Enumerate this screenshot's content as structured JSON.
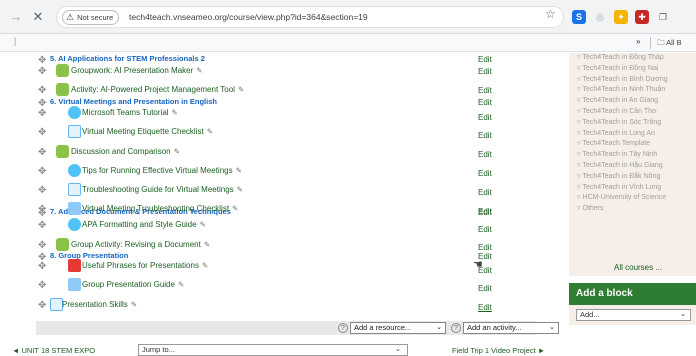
{
  "browser": {
    "nav_forward": "→",
    "nav_close": "✕",
    "security_label": "Not secure",
    "url": "tech4teach.vnseameo.org/course/view.php?id=364&section=19",
    "bookmarks_more": "»",
    "bookmarks_folder": "All B",
    "extensions": [
      {
        "icon": "s-extension-icon",
        "glyph": "S",
        "color": "#1a73e8"
      },
      {
        "icon": "shield-extension-icon",
        "glyph": "◎",
        "color": "#9aa0a6"
      },
      {
        "icon": "rocket-extension-icon",
        "glyph": "✦",
        "color": "#f4b400"
      },
      {
        "icon": "puzzle-extension-icon",
        "glyph": "✚",
        "color": "#c62828"
      },
      {
        "icon": "copy-extension-icon",
        "glyph": "❐",
        "color": "#5f6368"
      }
    ]
  },
  "course": {
    "sections": [
      {
        "title": "5. AI Applications for STEM Professionals 2"
      },
      {
        "title": "6. Virtual Meetings and Presentation in English"
      },
      {
        "title": "7. Advanced Document & Presentation Techniques"
      },
      {
        "title": "8. Group Presentation"
      }
    ],
    "activities": [
      {
        "name": "Groupwork: AI Presentation Maker",
        "icon": "forum-icon"
      },
      {
        "name": "Activity: AI-Powered Project Management Tool",
        "icon": "forum-icon"
      },
      {
        "name": "Microsoft Teams Tutorial",
        "icon": "url-icon"
      },
      {
        "name": "Virtual Meeting Etiquette Checklist",
        "icon": "file-icon"
      },
      {
        "name": "Discussion and Comparison",
        "icon": "forum-icon"
      },
      {
        "name": "Tips for Running Effective Virtual Meetings",
        "icon": "url-icon"
      },
      {
        "name": "Troubleshooting Guide for Virtual Meetings",
        "icon": "file-icon"
      },
      {
        "name": "Virtual Meeting Troubleshooting Checklist",
        "icon": "assignment-icon"
      },
      {
        "name": "APA Formatting and Style Guide",
        "icon": "url-icon"
      },
      {
        "name": "Group Activity: Revising a Document",
        "icon": "forum-icon"
      },
      {
        "name": "Useful Phrases for Presentations",
        "icon": "pdf-icon"
      },
      {
        "name": "Group Presentation Guide",
        "icon": "assignment-icon"
      },
      {
        "name": "Presentation Skills",
        "icon": "file-icon"
      }
    ],
    "edit_label": "Edit",
    "add_resource": "Add a resource...",
    "add_activity": "Add an activity..."
  },
  "footer": {
    "prev": "◄ UNIT 18 STEM EXPO",
    "jump_to": "Jump to...",
    "next": "Field Trip 1 Video Project ►"
  },
  "sidebar": {
    "items": [
      "Tech4Teach in Đồng Tháp",
      "Tech4Teach in Đồng Nai",
      "Tech4Teach in Bình Dương",
      "Tech4Teach in Ninh Thuận",
      "Tech4Teach in An Giang",
      "Tech4Teach in Cần Thơ",
      "Tech4Teach in Sóc Trăng",
      "Tech4Teach in Long An",
      "Tech4Teach Template",
      "Tech4Teach in Tây Ninh",
      "Tech4Teach in Hậu Giang",
      "Tech4Teach in Đắk Nông",
      "Tech4Teach in Vĩnh Long",
      "HCM-University of Science",
      "Others"
    ],
    "all_courses": "All courses ...",
    "add_block_title": "Add a block",
    "add_block_select": "Add..."
  }
}
